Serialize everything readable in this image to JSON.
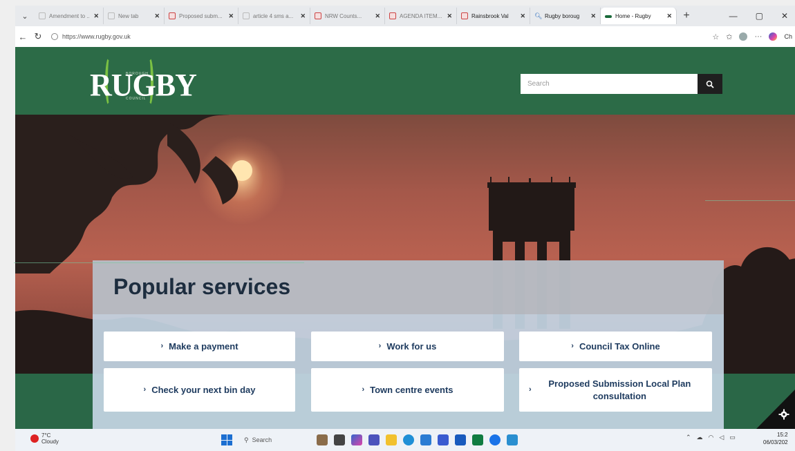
{
  "browser": {
    "tabs": [
      {
        "title": "Amendment to ...",
        "icon": "page-icon",
        "active": false,
        "dark": false
      },
      {
        "title": "New tab",
        "icon": "page-icon",
        "active": false,
        "dark": false
      },
      {
        "title": "Proposed subm...",
        "icon": "pdf-icon",
        "active": false,
        "dark": false
      },
      {
        "title": "article 4 sms a...",
        "icon": "page-icon",
        "active": false,
        "dark": false
      },
      {
        "title": "NRW Counts...",
        "icon": "pdf-icon",
        "active": false,
        "dark": false
      },
      {
        "title": "AGENDA ITEM...",
        "icon": "pdf-icon",
        "active": false,
        "dark": false
      },
      {
        "title": "Rainsbrook Val",
        "icon": "pdf-icon",
        "active": false,
        "dark": true
      },
      {
        "title": "Rugby boroug",
        "icon": "search-icon",
        "active": false,
        "dark": true
      },
      {
        "title": "Home - Rugby",
        "icon": "rugby-icon",
        "active": true,
        "dark": true
      }
    ],
    "new_tab": "+",
    "url": "https://www.rugby.gov.uk",
    "copilot_label": "Ch"
  },
  "site": {
    "logo": {
      "word": "RUGBY",
      "small_top": "BOROUGH",
      "small_bottom": "COUNCIL"
    },
    "search": {
      "placeholder": "Search"
    },
    "popular": {
      "title": "Popular services",
      "services": [
        "Make a payment",
        "Work for us",
        "Council Tax Online",
        "Check your next bin day",
        "Town centre events",
        "Proposed Submission Local Plan consultation"
      ]
    }
  },
  "taskbar": {
    "weather_temp": "7°C",
    "weather_desc": "Cloudy",
    "search_label": "Search",
    "time": "15:2",
    "date": "06/03/202"
  },
  "colors": {
    "header_green": "#2c6b47",
    "logo_accent": "#7bc143",
    "service_text": "#1d3a5e",
    "panel_blue": "#c6d6e5"
  }
}
